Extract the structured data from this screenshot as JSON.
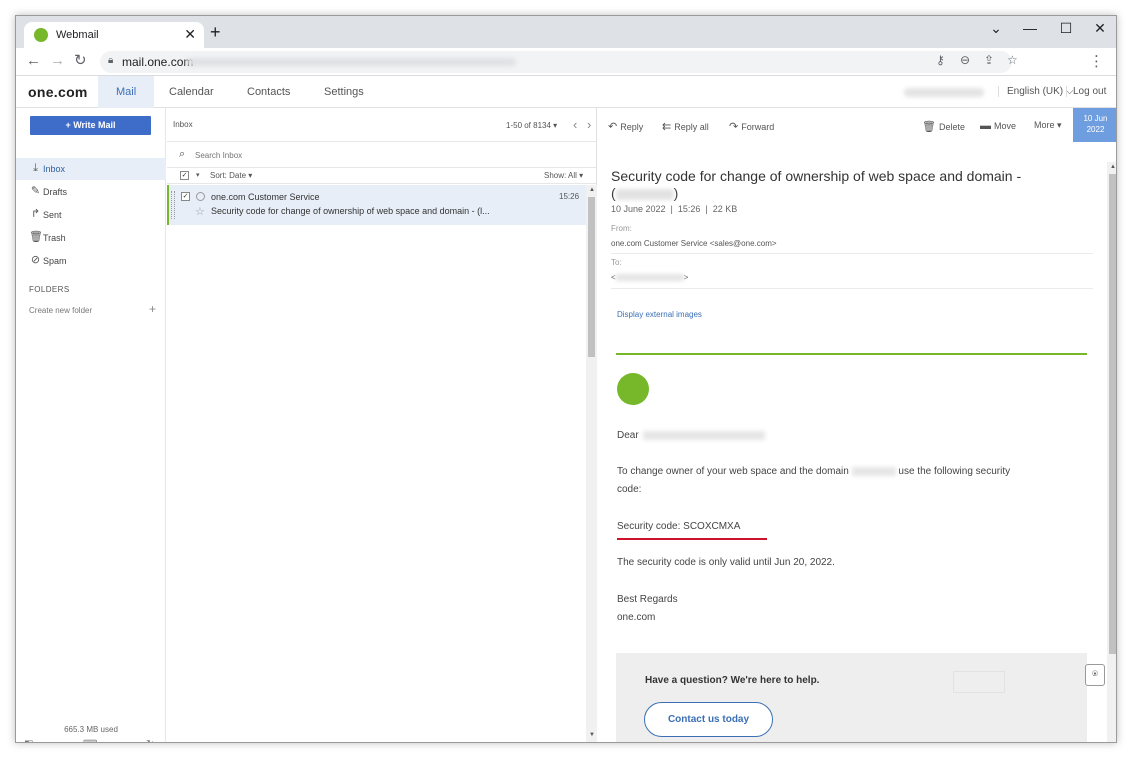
{
  "browser": {
    "tab_title": "Webmail",
    "url": "mail.one.com",
    "icons": [
      "webmail-favicon",
      "close-icon",
      "plus-icon",
      "back-icon",
      "forward-icon",
      "reload-icon",
      "lock-icon",
      "key-icon",
      "zoom-icon",
      "share-icon",
      "star-icon",
      "menu-icon"
    ]
  },
  "nav": {
    "logo": "one.com",
    "tabs": [
      "Mail",
      "Calendar",
      "Contacts",
      "Settings"
    ],
    "language": "English (UK)",
    "logout": "Log out"
  },
  "sidebar": {
    "write_mail": "+ Write Mail",
    "items": [
      {
        "label": "Inbox",
        "icon": "inbox-icon"
      },
      {
        "label": "Drafts",
        "icon": "drafts-icon"
      },
      {
        "label": "Sent",
        "icon": "sent-icon"
      },
      {
        "label": "Trash",
        "icon": "trash-icon"
      },
      {
        "label": "Spam",
        "icon": "spam-icon"
      }
    ],
    "folders_heading": "FOLDERS",
    "create_folder": "Create new folder",
    "usage": "665.3 MB used"
  },
  "list": {
    "title": "Inbox",
    "range": "1-50 of 8134",
    "search_placeholder": "Search Inbox",
    "sort_label": "Sort: Date",
    "show_label": "Show: All",
    "messages": [
      {
        "from": "one.com Customer Service",
        "time": "15:26",
        "subject": "Security code for change of ownership of web space and domain - (l..."
      }
    ]
  },
  "reader": {
    "toolbar": {
      "reply": "Reply",
      "reply_all": "Reply all",
      "forward": "Forward",
      "delete": "Delete",
      "move": "Move",
      "more": "More"
    },
    "date_tile": {
      "day": "10 Jun",
      "year": "2022"
    },
    "subject": "Security code for change of ownership of web space and domain -",
    "subject_open": "(",
    "subject_close": ")",
    "meta": "10 June 2022  |  15:26  |  22 KB",
    "from_label": "From:",
    "from_value": "one.com Customer Service <sales@one.com>",
    "to_label": "To:",
    "to_open": "<",
    "to_close": ">",
    "external_images": "Display external images",
    "body": {
      "greeting": "Dear",
      "intro_pre": "To change owner of your web space and the domain",
      "intro_post": "use the following security",
      "intro_line2": "code:",
      "security_code": "Security code: SCOXCMXA",
      "validity": "The security code is only valid until Jun 20, 2022.",
      "regards": "Best Regards",
      "signature": "one.com"
    },
    "help": {
      "text": "Have a question? We're here to help.",
      "button": "Contact us today"
    }
  }
}
